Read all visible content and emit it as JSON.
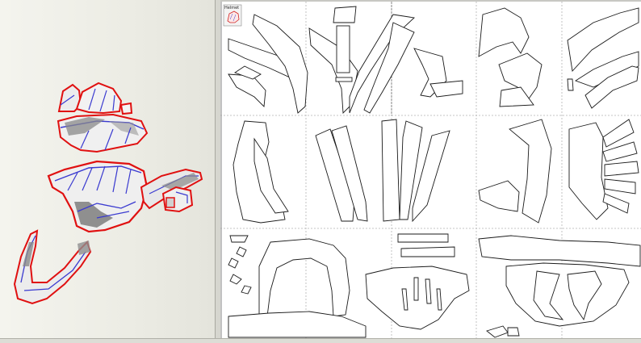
{
  "thumbnail": {
    "label": "Helmet"
  },
  "status": {
    "left_text": "",
    "right_text": ""
  },
  "colors": {
    "model_outline": "#e01010",
    "model_fold": "#3a3ad0",
    "model_fill": "#f0f0f0",
    "model_shade": "#8a8a8a",
    "page_background": "#ffffff",
    "page_grid_line": "#b4b4b4",
    "part_outline": "#1a1a1a"
  },
  "icons": {
    "thumbnail_icon": "helmet-thumbnail-icon"
  }
}
